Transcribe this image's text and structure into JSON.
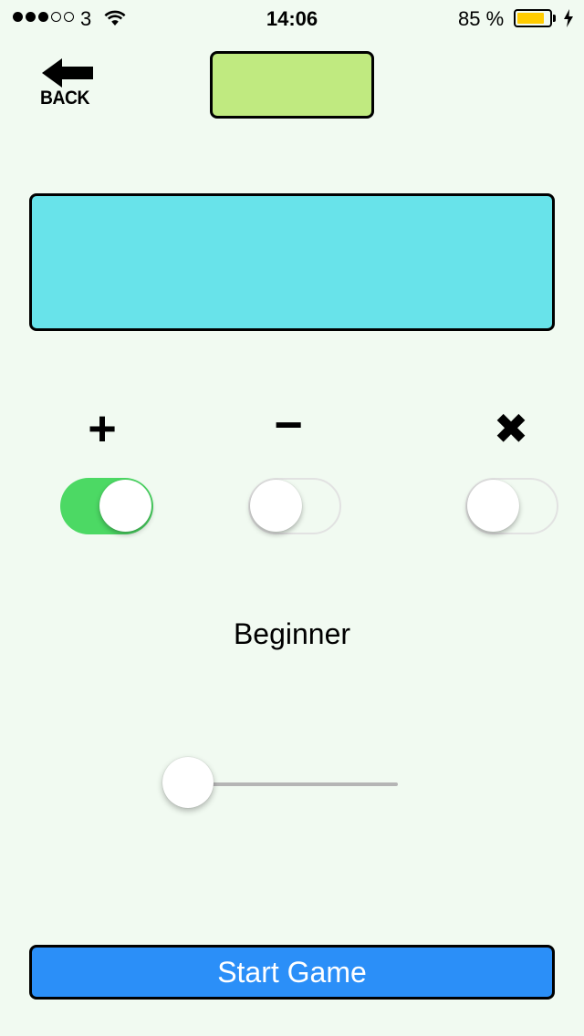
{
  "status_bar": {
    "signal_filled": 3,
    "signal_total": 5,
    "carrier": "3",
    "time": "14:06",
    "battery_percent_label": "85 %",
    "battery_level": 0.85,
    "battery_color": "#ffcc00"
  },
  "nav": {
    "back_label": "BACK"
  },
  "boxes": {
    "score_color": "#c0ea80",
    "question_color": "#68e3ea"
  },
  "operators": [
    {
      "symbol": "+",
      "name": "plus",
      "enabled": true
    },
    {
      "symbol": "−",
      "name": "minus",
      "enabled": false
    },
    {
      "symbol": "✖",
      "name": "times",
      "enabled": false
    }
  ],
  "difficulty": {
    "label": "Beginner",
    "slider_value": 0
  },
  "start_button": {
    "label": "Start Game",
    "color": "#2b8ff8"
  },
  "colors": {
    "background": "#f1faf1",
    "toggle_on": "#4cd964"
  }
}
